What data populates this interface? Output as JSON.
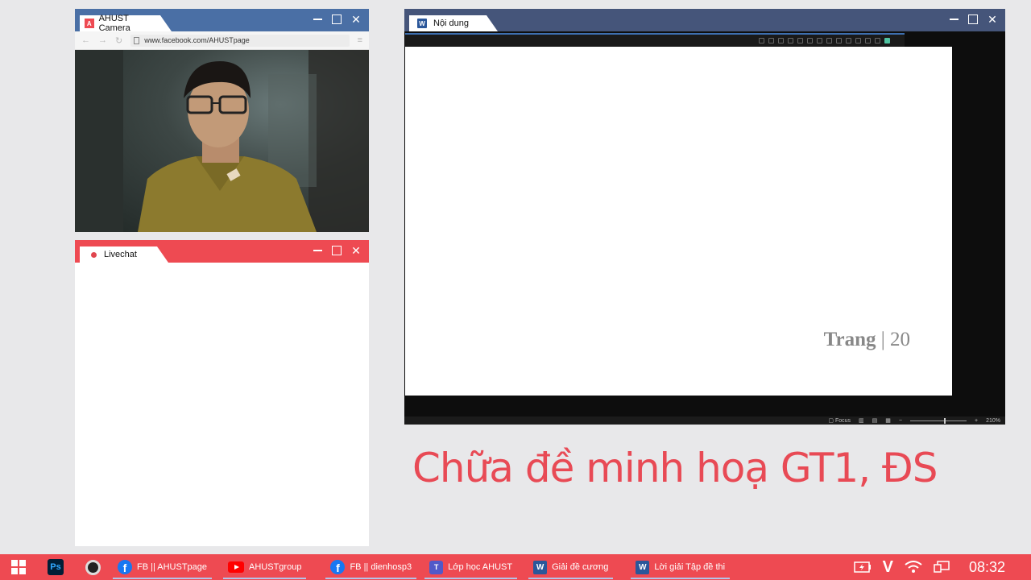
{
  "camera_window": {
    "tab_title": "AHUST Camera",
    "url": "www.facebook.com/AHUSTpage"
  },
  "livechat_window": {
    "tab_title": "Livechat"
  },
  "content_window": {
    "tab_title": "Nội dung",
    "page_label": "Trang",
    "page_separator": "|",
    "page_number": "20",
    "status_focus": "Focus",
    "zoom": "210%"
  },
  "headline": "Chữa đề minh hoạ GT1, ĐS",
  "taskbar": {
    "items": [
      {
        "label": "FB || AHUSTpage",
        "icon": "facebook-icon"
      },
      {
        "label": "AHUSTgroup",
        "icon": "youtube-icon"
      },
      {
        "label": "FB || dienhosp3",
        "icon": "facebook-icon"
      },
      {
        "label": "Lớp học AHUST",
        "icon": "teams-icon"
      },
      {
        "label": "Giải đề cương",
        "icon": "word-icon"
      },
      {
        "label": "Lời giải Tập đề thi",
        "icon": "word-icon"
      }
    ],
    "clock": "08:32"
  },
  "colors": {
    "accent_red": "#ee4a52",
    "camera_titlebar": "#4a6fa5",
    "content_titlebar": "#45557a",
    "headline": "#e84a55"
  }
}
